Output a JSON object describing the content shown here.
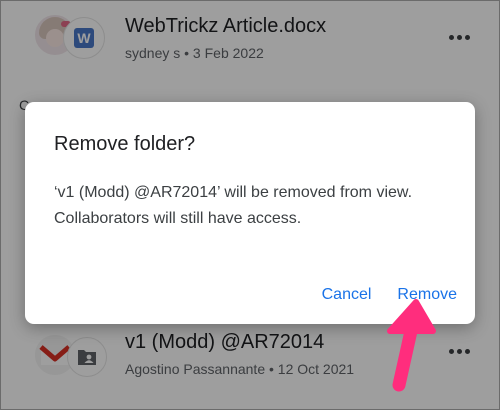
{
  "file_list": {
    "rows": [
      {
        "title": "WebTrickz Article.docx",
        "meta": "sydney s • 3 Feb 2022",
        "type_icon_letter": "W",
        "type_icon": "word-doc-icon",
        "avatar_icon": "user-avatar-icon",
        "more_icon": "more-horizontal-icon"
      },
      {
        "title": "v1 (Modd) @AR72014",
        "meta": "Agostino Passannante • 12 Oct 2021",
        "type_icon": "shared-folder-icon",
        "avatar_icon": "gmail-avatar-icon",
        "more_icon": "more-horizontal-icon"
      }
    ],
    "section_initial": "C"
  },
  "dialog": {
    "title": "Remove folder?",
    "body_line_1": "‘v1 (Modd) @AR72014’ will be removed from view.",
    "body_line_2": "Collaborators will still have access.",
    "cancel_label": "Cancel",
    "remove_label": "Remove"
  },
  "colors": {
    "accent": "#1a73e8",
    "annotation_arrow": "#ff2d7d",
    "scrim": "rgba(0,0,0,0.38)"
  }
}
